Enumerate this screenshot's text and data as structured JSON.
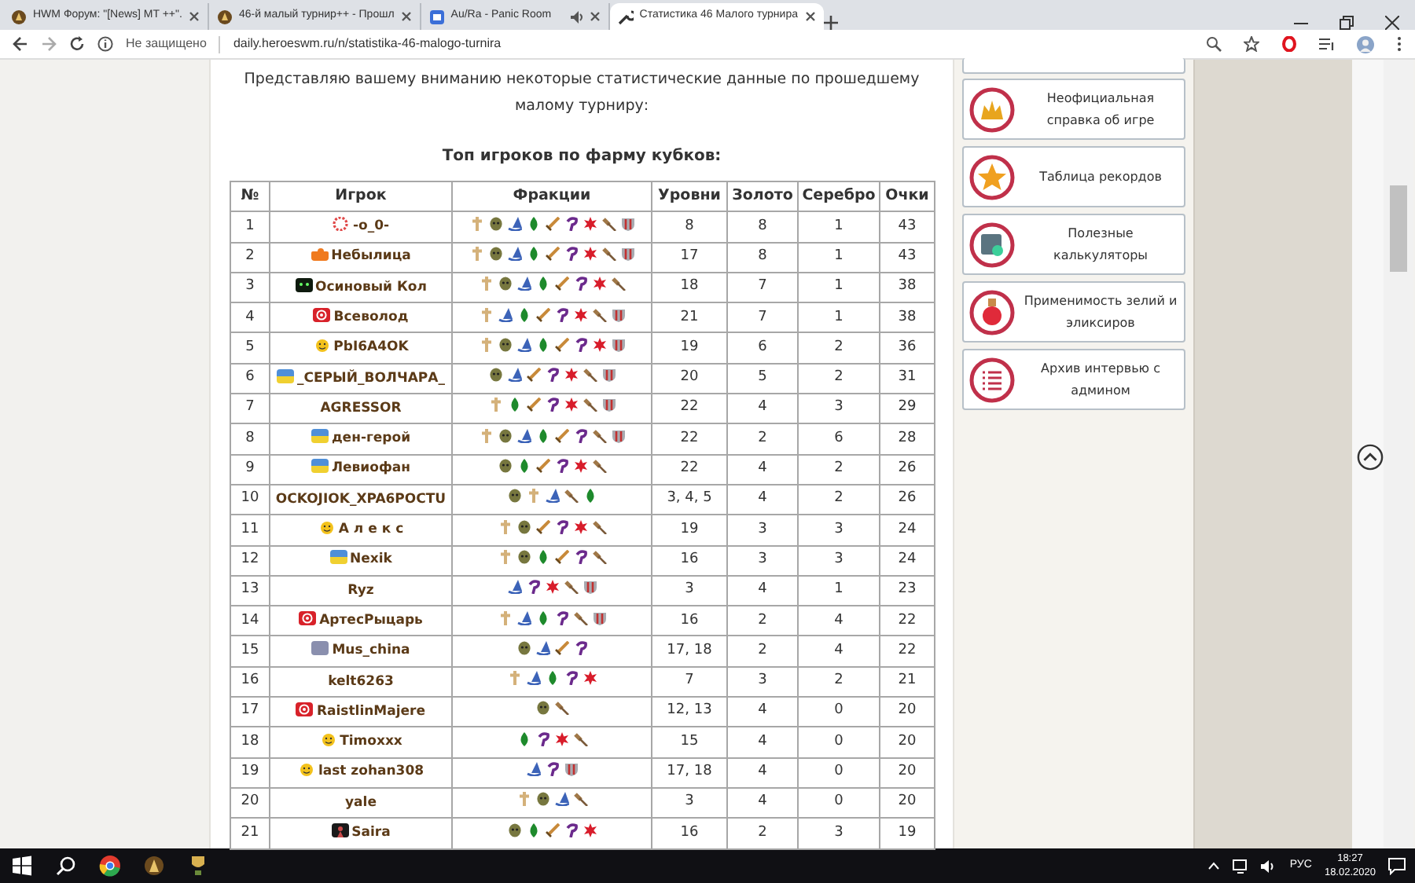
{
  "browser": {
    "tabs": [
      {
        "title": "HWM Форум: \"[News] MT ++\".",
        "kind": "horse",
        "selected": false,
        "audio": false
      },
      {
        "title": "46-й малый турнир++ - Прошл",
        "kind": "horse",
        "selected": false,
        "audio": false
      },
      {
        "title": "Au/Ra - Panic Room",
        "kind": "video",
        "selected": false,
        "audio": true
      },
      {
        "title": "Статистика 46 Малого турнира",
        "kind": "wrench",
        "selected": true,
        "audio": false
      }
    ],
    "security": "Не защищено",
    "url": "daily.heroeswm.ru/n/statistika-46-malogo-turnira"
  },
  "article": {
    "intro": "Представляю вашему вниманию некоторые статистические данные по прошедшему малому турниру:",
    "table_title": "Топ игроков по фарму кубков:",
    "table": {
      "columns": [
        "№",
        "Игрок",
        "Фракции",
        "Уровни",
        "Золото",
        "Серебро",
        "Очки"
      ],
      "rows": [
        {
          "num": "1",
          "avatar": {
            "kind": "snowflake"
          },
          "player": "-o_0-",
          "factions": [
            {
              "kind": "cross"
            },
            {
              "kind": "skull"
            },
            {
              "kind": "hat"
            },
            {
              "kind": "leaf"
            },
            {
              "kind": "sword"
            },
            {
              "kind": "hook"
            },
            {
              "kind": "star"
            },
            {
              "kind": "hammer"
            },
            {
              "kind": "shield"
            }
          ],
          "levels": "8",
          "gold": "8",
          "silver": "1",
          "points": "43"
        },
        {
          "num": "2",
          "avatar": {
            "kind": "puzzle"
          },
          "player": "Небылица",
          "factions": [
            {
              "kind": "cross"
            },
            {
              "kind": "skull"
            },
            {
              "kind": "hat"
            },
            {
              "kind": "leaf"
            },
            {
              "kind": "sword"
            },
            {
              "kind": "hook"
            },
            {
              "kind": "star"
            },
            {
              "kind": "hammer"
            },
            {
              "kind": "shield"
            }
          ],
          "levels": "17",
          "gold": "8",
          "silver": "1",
          "points": "43"
        },
        {
          "num": "3",
          "avatar": {
            "kind": "monster"
          },
          "player": "Осиновый Кол",
          "factions": [
            {
              "kind": "cross"
            },
            {
              "kind": "skull"
            },
            {
              "kind": "hat"
            },
            {
              "kind": "leaf"
            },
            {
              "kind": "sword"
            },
            {
              "kind": "hook"
            },
            {
              "kind": "star"
            },
            {
              "kind": "hammer"
            }
          ],
          "levels": "18",
          "gold": "7",
          "silver": "1",
          "points": "38"
        },
        {
          "num": "4",
          "avatar": {
            "kind": "target"
          },
          "player": "Всеволод",
          "factions": [
            {
              "kind": "cross"
            },
            {
              "kind": "hat"
            },
            {
              "kind": "leaf"
            },
            {
              "kind": "sword"
            },
            {
              "kind": "hook"
            },
            {
              "kind": "star"
            },
            {
              "kind": "hammer"
            },
            {
              "kind": "shield"
            }
          ],
          "levels": "21",
          "gold": "7",
          "silver": "1",
          "points": "38"
        },
        {
          "num": "5",
          "avatar": {
            "kind": "smiley"
          },
          "player": "PbI6A4OK",
          "factions": [
            {
              "kind": "cross"
            },
            {
              "kind": "skull"
            },
            {
              "kind": "hat"
            },
            {
              "kind": "leaf"
            },
            {
              "kind": "sword"
            },
            {
              "kind": "hook"
            },
            {
              "kind": "star"
            },
            {
              "kind": "shield"
            }
          ],
          "levels": "19",
          "gold": "6",
          "silver": "2",
          "points": "36"
        },
        {
          "num": "6",
          "avatar": {
            "kind": "flag"
          },
          "player": "_СЕРЫЙ_ВОЛЧАРА_",
          "factions": [
            {
              "kind": "skull"
            },
            {
              "kind": "hat"
            },
            {
              "kind": "sword"
            },
            {
              "kind": "hook"
            },
            {
              "kind": "star"
            },
            {
              "kind": "hammer"
            },
            {
              "kind": "shield"
            }
          ],
          "levels": "20",
          "gold": "5",
          "silver": "2",
          "points": "31"
        },
        {
          "num": "7",
          "player": "AGRESSOR",
          "factions": [
            {
              "kind": "cross"
            },
            {
              "kind": "leaf"
            },
            {
              "kind": "sword"
            },
            {
              "kind": "hook"
            },
            {
              "kind": "star"
            },
            {
              "kind": "hammer"
            },
            {
              "kind": "shield"
            }
          ],
          "levels": "22",
          "gold": "4",
          "silver": "3",
          "points": "29"
        },
        {
          "num": "8",
          "avatar": {
            "kind": "flag"
          },
          "player": "ден-герой",
          "factions": [
            {
              "kind": "cross"
            },
            {
              "kind": "skull"
            },
            {
              "kind": "hat"
            },
            {
              "kind": "leaf"
            },
            {
              "kind": "sword"
            },
            {
              "kind": "hook"
            },
            {
              "kind": "hammer"
            },
            {
              "kind": "shield"
            }
          ],
          "levels": "22",
          "gold": "2",
          "silver": "6",
          "points": "28"
        },
        {
          "num": "9",
          "avatar": {
            "kind": "flag"
          },
          "player": "Левиофан",
          "factions": [
            {
              "kind": "skull"
            },
            {
              "kind": "leaf"
            },
            {
              "kind": "sword"
            },
            {
              "kind": "hook"
            },
            {
              "kind": "star"
            },
            {
              "kind": "hammer"
            }
          ],
          "levels": "22",
          "gold": "4",
          "silver": "2",
          "points": "26"
        },
        {
          "num": "10",
          "player": "OCKOJIOK_XPA6POCTU",
          "factions": [
            {
              "kind": "skull"
            },
            {
              "kind": "cross"
            },
            {
              "kind": "hat"
            },
            {
              "kind": "hammer"
            },
            {
              "kind": "leaf"
            }
          ],
          "levels": "3, 4, 5",
          "gold": "4",
          "silver": "2",
          "points": "26"
        },
        {
          "num": "11",
          "avatar": {
            "kind": "smiley"
          },
          "player": "А л е к с",
          "factions": [
            {
              "kind": "cross"
            },
            {
              "kind": "skull"
            },
            {
              "kind": "sword"
            },
            {
              "kind": "hook"
            },
            {
              "kind": "star"
            },
            {
              "kind": "hammer"
            }
          ],
          "levels": "19",
          "gold": "3",
          "silver": "3",
          "points": "24"
        },
        {
          "num": "12",
          "avatar": {
            "kind": "flag"
          },
          "player": "Nexik",
          "factions": [
            {
              "kind": "cross"
            },
            {
              "kind": "skull"
            },
            {
              "kind": "leaf"
            },
            {
              "kind": "sword"
            },
            {
              "kind": "hook"
            },
            {
              "kind": "hammer"
            }
          ],
          "levels": "16",
          "gold": "3",
          "silver": "3",
          "points": "24"
        },
        {
          "num": "13",
          "player": "Ryz",
          "factions": [
            {
              "kind": "hat"
            },
            {
              "kind": "hook"
            },
            {
              "kind": "star"
            },
            {
              "kind": "hammer"
            },
            {
              "kind": "shield"
            }
          ],
          "levels": "3",
          "gold": "4",
          "silver": "1",
          "points": "23"
        },
        {
          "num": "14",
          "avatar": {
            "kind": "target"
          },
          "player": "АртесРыцарь",
          "factions": [
            {
              "kind": "cross"
            },
            {
              "kind": "hat"
            },
            {
              "kind": "leaf"
            },
            {
              "kind": "hook"
            },
            {
              "kind": "hammer"
            },
            {
              "kind": "shield"
            }
          ],
          "levels": "16",
          "gold": "2",
          "silver": "4",
          "points": "22"
        },
        {
          "num": "15",
          "avatar": {
            "kind": "photo"
          },
          "player": "Mus_china",
          "factions": [
            {
              "kind": "skull"
            },
            {
              "kind": "hat"
            },
            {
              "kind": "sword"
            },
            {
              "kind": "hook"
            }
          ],
          "levels": "17, 18",
          "gold": "2",
          "silver": "4",
          "points": "22"
        },
        {
          "num": "16",
          "player": "kelt6263",
          "factions": [
            {
              "kind": "cross"
            },
            {
              "kind": "hat"
            },
            {
              "kind": "leaf"
            },
            {
              "kind": "hook"
            },
            {
              "kind": "star"
            }
          ],
          "levels": "7",
          "gold": "3",
          "silver": "2",
          "points": "21"
        },
        {
          "num": "17",
          "avatar": {
            "kind": "target"
          },
          "player": "RaistlinMajere",
          "factions": [
            {
              "kind": "skull"
            },
            {
              "kind": "hammer"
            }
          ],
          "levels": "12, 13",
          "gold": "4",
          "silver": "0",
          "points": "20"
        },
        {
          "num": "18",
          "avatar": {
            "kind": "smiley"
          },
          "player": "Timoxxx",
          "factions": [
            {
              "kind": "leaf"
            },
            {
              "kind": "hook"
            },
            {
              "kind": "star"
            },
            {
              "kind": "hammer"
            }
          ],
          "levels": "15",
          "gold": "4",
          "silver": "0",
          "points": "20"
        },
        {
          "num": "19",
          "avatar": {
            "kind": "smiley"
          },
          "player": "last zohan308",
          "factions": [
            {
              "kind": "hat"
            },
            {
              "kind": "hook"
            },
            {
              "kind": "shield"
            }
          ],
          "levels": "17, 18",
          "gold": "4",
          "silver": "0",
          "points": "20"
        },
        {
          "num": "20",
          "player": "yale",
          "factions": [
            {
              "kind": "cross"
            },
            {
              "kind": "skull"
            },
            {
              "kind": "hat"
            },
            {
              "kind": "hammer"
            }
          ],
          "levels": "3",
          "gold": "4",
          "silver": "0",
          "points": "20"
        },
        {
          "num": "21",
          "avatar": {
            "kind": "dark"
          },
          "player": "Saira",
          "factions": [
            {
              "kind": "skull"
            },
            {
              "kind": "leaf"
            },
            {
              "kind": "sword"
            },
            {
              "kind": "hook"
            },
            {
              "kind": "star"
            }
          ],
          "levels": "16",
          "gold": "2",
          "silver": "3",
          "points": "19"
        }
      ]
    }
  },
  "sidebar": {
    "items": [
      {
        "label": "Неофициальная справка об игре",
        "kind": "crown"
      },
      {
        "label": "Таблица рекордов",
        "kind": "star"
      },
      {
        "label": "Полезные калькуляторы",
        "kind": "calculator"
      },
      {
        "label": "Применимость зелий и эликсиров",
        "kind": "potion"
      },
      {
        "label": "Архив интервью с админом",
        "kind": "list"
      }
    ]
  },
  "taskbar": {
    "language": "РУС",
    "time": "18:27",
    "date": "18.02.2020"
  }
}
